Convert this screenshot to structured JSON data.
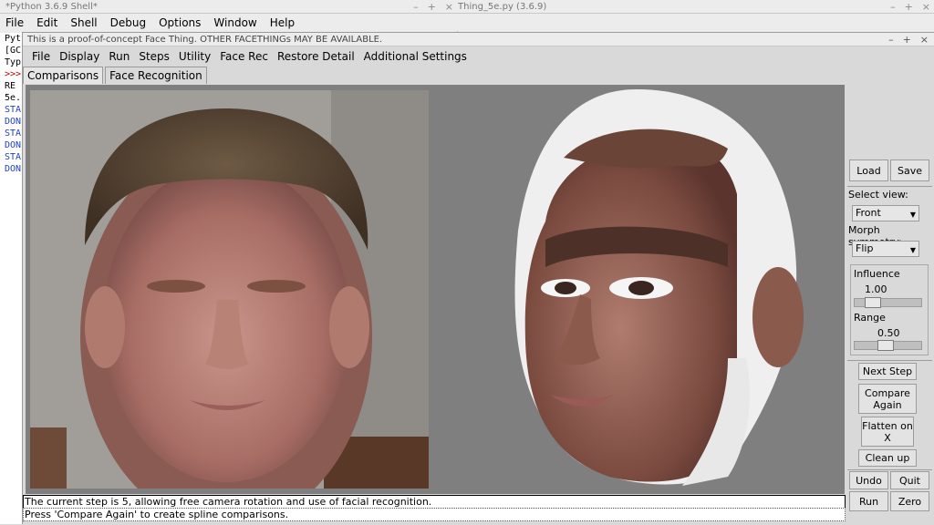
{
  "shell": {
    "title": "*Python 3.6.9 Shell*",
    "controls": [
      "–",
      "+",
      "×"
    ],
    "menu": [
      "File",
      "Edit",
      "Shell",
      "Debug",
      "Options",
      "Window",
      "Help"
    ],
    "lines": [
      {
        "text": "Pyt",
        "color": "black"
      },
      {
        "text": "[GC",
        "color": "black"
      },
      {
        "text": "Typ",
        "color": "black"
      },
      {
        "text": ">>>",
        "color": "red"
      },
      {
        "text": " RE",
        "color": "black"
      },
      {
        "text": "5e.",
        "color": "black"
      },
      {
        "text": "STA",
        "color": "blue"
      },
      {
        "text": "DON",
        "color": "blue"
      },
      {
        "text": "STA",
        "color": "blue"
      },
      {
        "text": "DON",
        "color": "blue"
      },
      {
        "text": "STA",
        "color": "blue"
      },
      {
        "text": "DON",
        "color": "blue"
      }
    ]
  },
  "editor": {
    "title": "Thing_5e.py (3.6.9)",
    "controls": [
      "–",
      "+",
      "×"
    ]
  },
  "main": {
    "title": "This is a proof-of-concept Face Thing.  OTHER FACETHINGs MAY BE AVAILABLE.",
    "controls": [
      "–",
      "+",
      "×"
    ],
    "menu": [
      "File",
      "Display",
      "Run",
      "Steps",
      "Utility",
      "Face Rec",
      "Restore Detail",
      "Additional Settings"
    ],
    "tabs": [
      "Comparisons",
      "Face Recognition"
    ],
    "active_tab": 0
  },
  "side": {
    "load": "Load",
    "save": "Save",
    "select_view_label": "Select view:",
    "select_view_value": "Front",
    "morph_label": "Morph symmetry:",
    "morph_value": "Flip",
    "influence_label": "Influence",
    "influence_value": "1.00",
    "influence_fraction": 0.2,
    "range_label": "Range",
    "range_value": "0.50",
    "range_fraction": 0.45,
    "next_step": "Next Step",
    "compare_again": "Compare Again",
    "flatten": "Flatten on X",
    "clean_up": "Clean up",
    "undo": "Undo",
    "quit": "Quit",
    "run": "Run",
    "zero": "Zero"
  },
  "status": {
    "line1": "The current step is 5, allowing free camera rotation and use of facial recognition.",
    "line2": "Press 'Compare Again' to create spline comparisons."
  },
  "colors": {
    "shell_blue": "#1f3fd0",
    "shell_red": "#c00000",
    "viewport_bg": "#7f7f7f"
  }
}
